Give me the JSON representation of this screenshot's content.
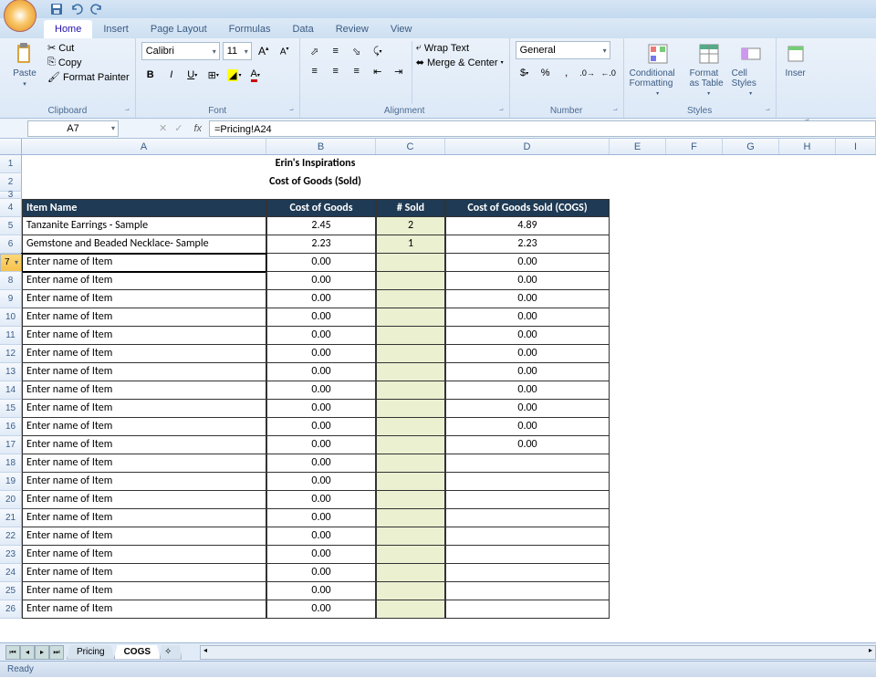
{
  "tabs": [
    "Home",
    "Insert",
    "Page Layout",
    "Formulas",
    "Data",
    "Review",
    "View"
  ],
  "activeTab": 0,
  "clipboard": {
    "paste": "Paste",
    "cut": "Cut",
    "copy": "Copy",
    "fp": "Format Painter",
    "label": "Clipboard"
  },
  "font": {
    "name": "Calibri",
    "size": "11",
    "label": "Font"
  },
  "alignment": {
    "wrap": "Wrap Text",
    "merge": "Merge & Center",
    "label": "Alignment"
  },
  "number": {
    "format": "General",
    "label": "Number"
  },
  "styles": {
    "cond": "Conditional Formatting",
    "fmt": "Format as Table",
    "cell": "Cell Styles",
    "label": "Styles"
  },
  "cells": {
    "ins": "Inser"
  },
  "namebox": "A7",
  "formula": "=Pricing!A24",
  "columns": [
    "A",
    "B",
    "C",
    "D",
    "E",
    "F",
    "G",
    "H",
    "I"
  ],
  "sheet": {
    "title1": "Erin's Inspirations",
    "title2": "Cost of Goods (Sold)",
    "hdr": {
      "a": "Item Name",
      "b": "Cost of Goods",
      "c": "# Sold",
      "d": "Cost of Goods Sold (COGS)"
    },
    "rows": [
      {
        "n": 5,
        "a": "Tanzanite Earrings - Sample",
        "b": "2.45",
        "c": "2",
        "d": "4.89"
      },
      {
        "n": 6,
        "a": "Gemstone and Beaded Necklace- Sample",
        "b": "2.23",
        "c": "1",
        "d": "2.23"
      },
      {
        "n": 7,
        "a": "Enter name of Item",
        "b": "0.00",
        "c": "",
        "d": "0.00",
        "sel": true
      },
      {
        "n": 8,
        "a": "Enter name of Item",
        "b": "0.00",
        "c": "",
        "d": "0.00"
      },
      {
        "n": 9,
        "a": "Enter name of Item",
        "b": "0.00",
        "c": "",
        "d": "0.00"
      },
      {
        "n": 10,
        "a": "Enter name of Item",
        "b": "0.00",
        "c": "",
        "d": "0.00"
      },
      {
        "n": 11,
        "a": "Enter name of Item",
        "b": "0.00",
        "c": "",
        "d": "0.00"
      },
      {
        "n": 12,
        "a": "Enter name of Item",
        "b": "0.00",
        "c": "",
        "d": "0.00"
      },
      {
        "n": 13,
        "a": "Enter name of Item",
        "b": "0.00",
        "c": "",
        "d": "0.00"
      },
      {
        "n": 14,
        "a": "Enter name of Item",
        "b": "0.00",
        "c": "",
        "d": "0.00"
      },
      {
        "n": 15,
        "a": "Enter name of Item",
        "b": "0.00",
        "c": "",
        "d": "0.00"
      },
      {
        "n": 16,
        "a": "Enter name of Item",
        "b": "0.00",
        "c": "",
        "d": "0.00"
      },
      {
        "n": 17,
        "a": "Enter name of Item",
        "b": "0.00",
        "c": "",
        "d": "0.00"
      },
      {
        "n": 18,
        "a": "Enter name of Item",
        "b": "0.00",
        "c": "",
        "d": ""
      },
      {
        "n": 19,
        "a": "Enter name of Item",
        "b": "0.00",
        "c": "",
        "d": ""
      },
      {
        "n": 20,
        "a": "Enter name of Item",
        "b": "0.00",
        "c": "",
        "d": ""
      },
      {
        "n": 21,
        "a": "Enter name of Item",
        "b": "0.00",
        "c": "",
        "d": ""
      },
      {
        "n": 22,
        "a": "Enter name of Item",
        "b": "0.00",
        "c": "",
        "d": ""
      },
      {
        "n": 23,
        "a": "Enter name of Item",
        "b": "0.00",
        "c": "",
        "d": ""
      },
      {
        "n": 24,
        "a": "Enter name of Item",
        "b": "0.00",
        "c": "",
        "d": ""
      },
      {
        "n": 25,
        "a": "Enter name of Item",
        "b": "0.00",
        "c": "",
        "d": ""
      },
      {
        "n": 26,
        "a": "Enter name of Item",
        "b": "0.00",
        "c": "",
        "d": ""
      }
    ]
  },
  "sheetTabs": [
    "Pricing",
    "COGS"
  ],
  "activeSheet": 1,
  "status": "Ready"
}
